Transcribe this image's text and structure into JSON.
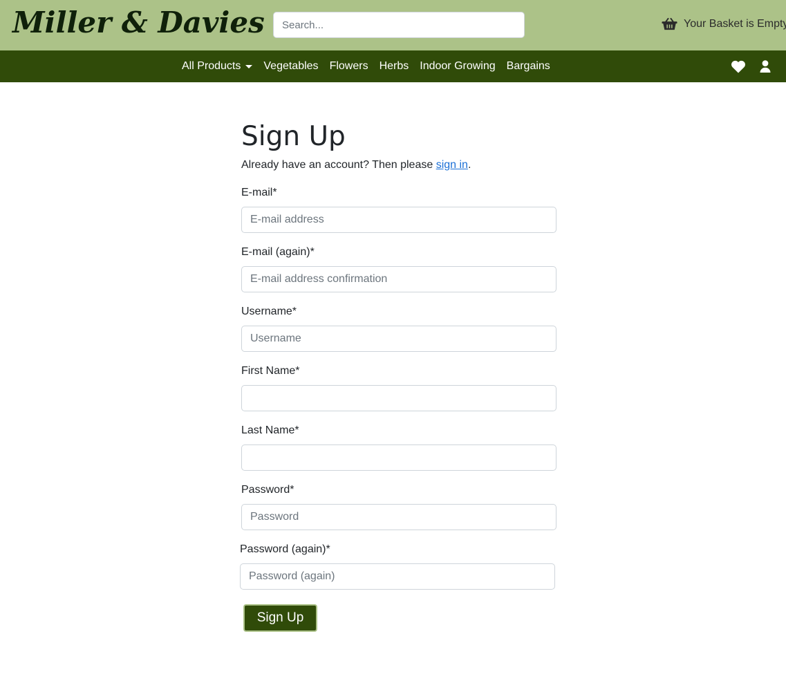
{
  "header": {
    "logo": "Miller & Davies",
    "search_placeholder": "Search...",
    "basket_text": "Your Basket is Empty",
    "basket_icon": "basket-icon"
  },
  "nav": {
    "items": [
      {
        "label": "All Products",
        "dropdown": true
      },
      {
        "label": "Vegetables"
      },
      {
        "label": "Flowers"
      },
      {
        "label": "Herbs"
      },
      {
        "label": "Indoor Growing"
      },
      {
        "label": "Bargains"
      }
    ],
    "icons": [
      "heart-icon",
      "user-icon"
    ]
  },
  "form": {
    "title": "Sign Up",
    "intro_prefix": "Already have an account? Then please ",
    "intro_link": "sign in",
    "intro_suffix": ".",
    "fields": [
      {
        "label": "E-mail*",
        "placeholder": "E-mail address",
        "value": ""
      },
      {
        "label": "E-mail (again)*",
        "placeholder": "E-mail address confirmation",
        "value": ""
      },
      {
        "label": "Username*",
        "placeholder": "Username",
        "value": ""
      },
      {
        "label": "First Name*",
        "placeholder": "",
        "value": ""
      },
      {
        "label": "Last Name*",
        "placeholder": "",
        "value": ""
      },
      {
        "label": "Password*",
        "placeholder": "Password",
        "value": ""
      },
      {
        "label": "Password (again)*",
        "placeholder": "Password (again)",
        "value": ""
      }
    ],
    "submit_label": "Sign Up"
  },
  "colors": {
    "header_bg": "#acc288",
    "nav_bg": "#304b09",
    "link": "#1a6fd6"
  }
}
